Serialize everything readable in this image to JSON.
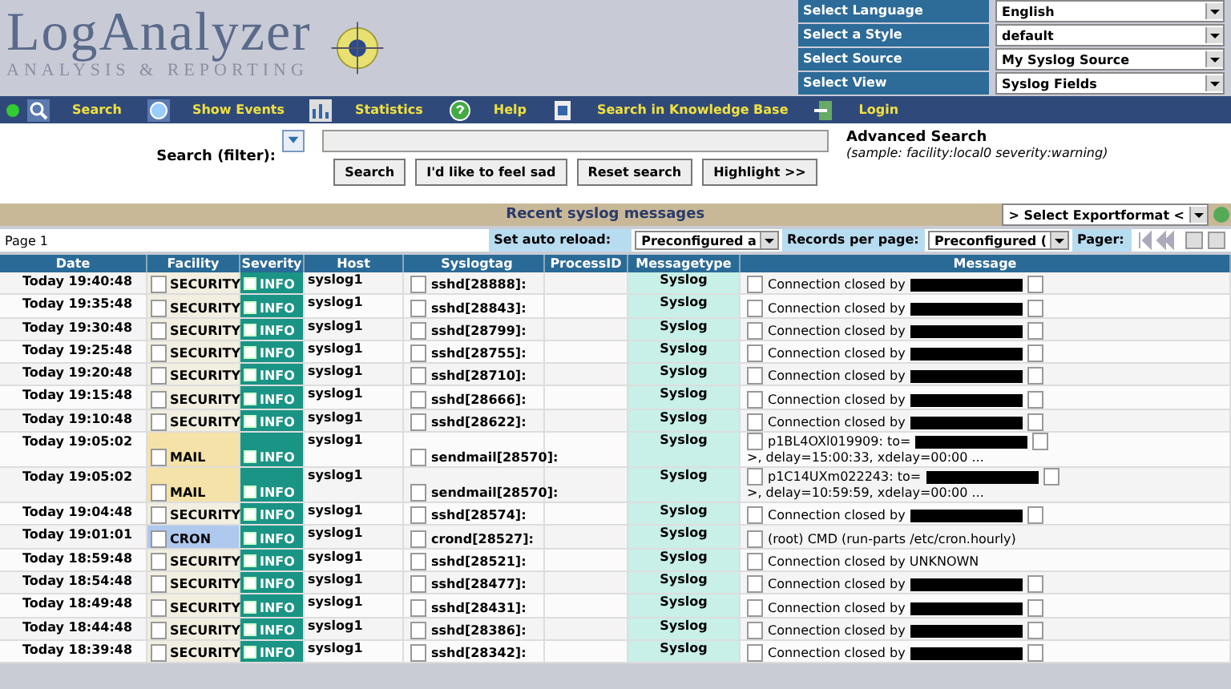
{
  "logo": {
    "title": "LogAnalyzer",
    "subtitle": "ANALYSIS & REPORTING"
  },
  "settings": [
    {
      "label": "Select Language",
      "value": "English"
    },
    {
      "label": "Select a Style",
      "value": "default"
    },
    {
      "label": "Select Source",
      "value": "My Syslog Source"
    },
    {
      "label": "Select View",
      "value": "Syslog Fields"
    }
  ],
  "nav": [
    {
      "label": "Search"
    },
    {
      "label": "Show Events"
    },
    {
      "label": "Statistics"
    },
    {
      "label": "Help"
    },
    {
      "label": "Search in Knowledge Base"
    },
    {
      "label": "Login"
    }
  ],
  "search": {
    "label": "Search (filter):",
    "advanced": "Advanced Search",
    "sample": "(sample: facility:local0 severity:warning)",
    "buttons": [
      "Search",
      "I'd like to feel sad",
      "Reset search",
      "Highlight >>"
    ]
  },
  "section_title": "Recent syslog messages",
  "export": "> Select Exportformat <",
  "pager_bar": {
    "page": "Page 1",
    "reload_label": "Set auto reload:",
    "reload_value": "Preconfigured a",
    "records_label": "Records per page:",
    "records_value": "Preconfigured (",
    "pager_label": "Pager:"
  },
  "table": {
    "columns": [
      "Date",
      "Facility",
      "Severity",
      "Host",
      "Syslogtag",
      "ProcessID",
      "Messagetype",
      "Message"
    ],
    "rows": [
      {
        "date": "Today 19:40:48",
        "facility": "SECURITY",
        "color": "#f2eee0",
        "severity": "INFO",
        "host": "syslog1",
        "syslogtag": "sshd[28888]:",
        "messagetype": "Syslog",
        "message": {
          "text": "Connection closed by",
          "redacted": true
        }
      },
      {
        "date": "Today 19:35:48",
        "facility": "SECURITY",
        "color": "#f2eee0",
        "severity": "INFO",
        "host": "syslog1",
        "syslogtag": "sshd[28843]:",
        "messagetype": "Syslog",
        "message": {
          "text": "Connection closed by",
          "redacted": true
        }
      },
      {
        "date": "Today 19:30:48",
        "facility": "SECURITY",
        "color": "#f2eee0",
        "severity": "INFO",
        "host": "syslog1",
        "syslogtag": "sshd[28799]:",
        "messagetype": "Syslog",
        "message": {
          "text": "Connection closed by",
          "redacted": true
        }
      },
      {
        "date": "Today 19:25:48",
        "facility": "SECURITY",
        "color": "#f2eee0",
        "severity": "INFO",
        "host": "syslog1",
        "syslogtag": "sshd[28755]:",
        "messagetype": "Syslog",
        "message": {
          "text": "Connection closed by",
          "redacted": true
        }
      },
      {
        "date": "Today 19:20:48",
        "facility": "SECURITY",
        "color": "#f2eee0",
        "severity": "INFO",
        "host": "syslog1",
        "syslogtag": "sshd[28710]:",
        "messagetype": "Syslog",
        "message": {
          "text": "Connection closed by",
          "redacted": true
        }
      },
      {
        "date": "Today 19:15:48",
        "facility": "SECURITY",
        "color": "#f2eee0",
        "severity": "INFO",
        "host": "syslog1",
        "syslogtag": "sshd[28666]:",
        "messagetype": "Syslog",
        "message": {
          "text": "Connection closed by",
          "redacted": true
        }
      },
      {
        "date": "Today 19:10:48",
        "facility": "SECURITY",
        "color": "#f2eee0",
        "severity": "INFO",
        "host": "syslog1",
        "syslogtag": "sshd[28622]:",
        "messagetype": "Syslog",
        "message": {
          "text": "Connection closed by",
          "redacted": true
        }
      },
      {
        "date": "Today 19:05:02",
        "facility": "MAIL",
        "color": "#f5e2a8",
        "severity": "INFO",
        "host": "syslog1",
        "syslogtag": "sendmail[28570]:",
        "messagetype": "Syslog",
        "message": {
          "text": "p1BL4OXl019909: to=",
          "redacted": true,
          "tail": ">, delay=15:00:33, xdelay=00:00 ..."
        }
      },
      {
        "date": "Today 19:05:02",
        "facility": "MAIL",
        "color": "#f5e2a8",
        "severity": "INFO",
        "host": "syslog1",
        "syslogtag": "sendmail[28570]:",
        "messagetype": "Syslog",
        "message": {
          "text": "p1C14UXm022243: to=",
          "redacted": true,
          "tail": ">, delay=10:59:59, xdelay=00:00 ..."
        }
      },
      {
        "date": "Today 19:04:48",
        "facility": "SECURITY",
        "color": "#f2eee0",
        "severity": "INFO",
        "host": "syslog1",
        "syslogtag": "sshd[28574]:",
        "messagetype": "Syslog",
        "message": {
          "text": "Connection closed by",
          "redacted": true
        }
      },
      {
        "date": "Today 19:01:01",
        "facility": "CRON",
        "color": "#aec8ee",
        "severity": "INFO",
        "host": "syslog1",
        "syslogtag": "crond[28527]:",
        "messagetype": "Syslog",
        "message": {
          "text": "(root) CMD (run-parts /etc/cron.hourly)",
          "redacted": false
        }
      },
      {
        "date": "Today 18:59:48",
        "facility": "SECURITY",
        "color": "#f2eee0",
        "severity": "INFO",
        "host": "syslog1",
        "syslogtag": "sshd[28521]:",
        "messagetype": "Syslog",
        "message": {
          "text": "Connection closed by UNKNOWN",
          "redacted": false
        }
      },
      {
        "date": "Today 18:54:48",
        "facility": "SECURITY",
        "color": "#f2eee0",
        "severity": "INFO",
        "host": "syslog1",
        "syslogtag": "sshd[28477]:",
        "messagetype": "Syslog",
        "message": {
          "text": "Connection closed by",
          "redacted": true
        }
      },
      {
        "date": "Today 18:49:48",
        "facility": "SECURITY",
        "color": "#f2eee0",
        "severity": "INFO",
        "host": "syslog1",
        "syslogtag": "sshd[28431]:",
        "messagetype": "Syslog",
        "message": {
          "text": "Connection closed by",
          "redacted": true
        }
      },
      {
        "date": "Today 18:44:48",
        "facility": "SECURITY",
        "color": "#f2eee0",
        "severity": "INFO",
        "host": "syslog1",
        "syslogtag": "sshd[28386]:",
        "messagetype": "Syslog",
        "message": {
          "text": "Connection closed by",
          "redacted": true
        }
      },
      {
        "date": "Today 18:39:48",
        "facility": "SECURITY",
        "color": "#f2eee0",
        "severity": "INFO",
        "host": "syslog1",
        "syslogtag": "sshd[28342]:",
        "messagetype": "Syslog",
        "message": {
          "text": "Connection closed by",
          "redacted": true
        }
      }
    ]
  }
}
